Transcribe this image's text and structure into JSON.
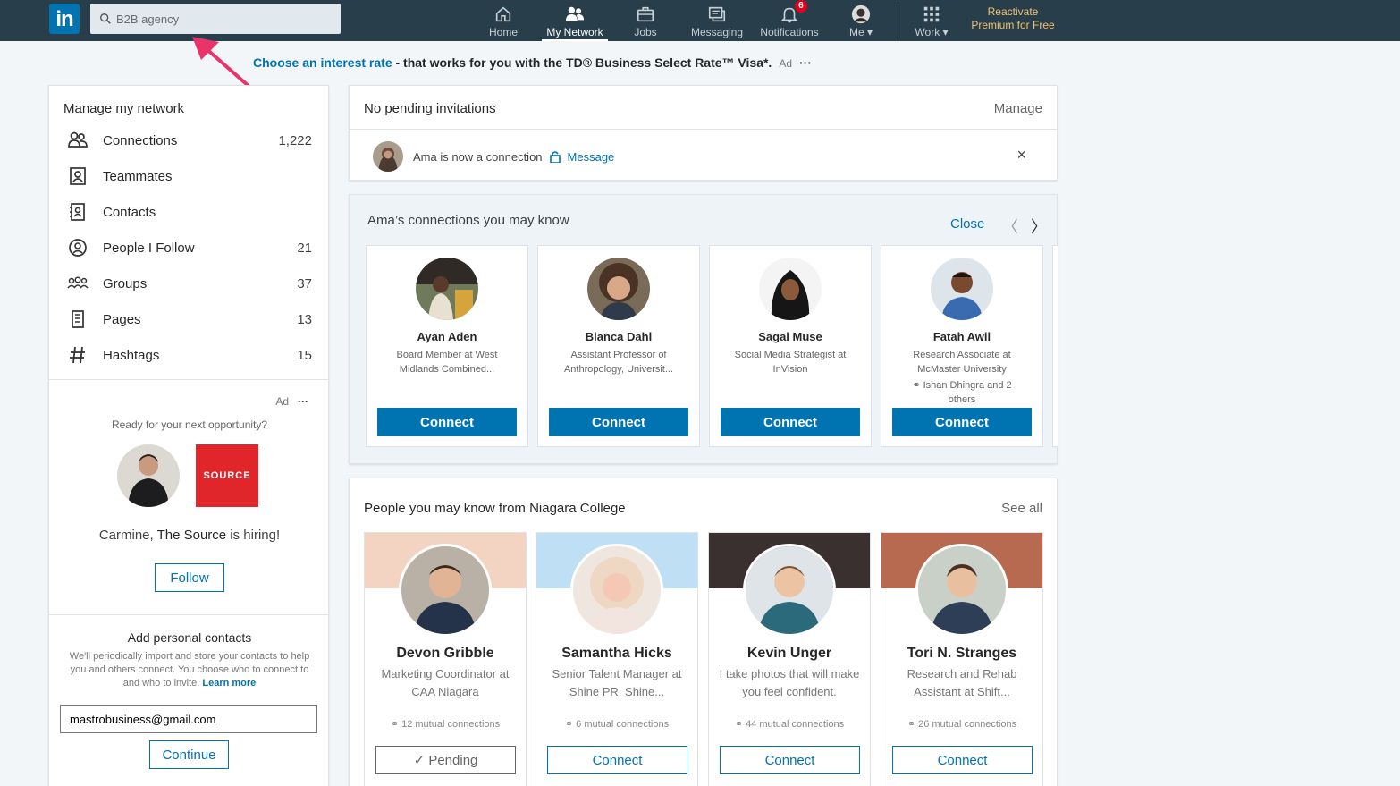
{
  "topbar": {
    "search_value": "B2B agency",
    "nav": [
      {
        "label": "Home",
        "icon": "home-icon"
      },
      {
        "label": "My Network",
        "icon": "network-icon"
      },
      {
        "label": "Jobs",
        "icon": "briefcase-icon"
      },
      {
        "label": "Messaging",
        "icon": "messaging-icon"
      },
      {
        "label": "Notifications",
        "icon": "bell-icon",
        "badge": "6"
      },
      {
        "label": "Me",
        "icon": "avatar"
      },
      {
        "label": "Work",
        "icon": "grid-icon"
      }
    ],
    "premium_line1": "Reactivate",
    "premium_line2": "Premium for Free"
  },
  "ad_banner": {
    "link": "Choose an interest rate",
    "rest": " - that works for you with the TD® Business Select Rate™ Visa*.",
    "ad": "Ad",
    "dots": "···"
  },
  "sidebar": {
    "title": "Manage my network",
    "items": [
      {
        "label": "Connections",
        "count": "1,222",
        "icon": "connections-icon"
      },
      {
        "label": "Teammates",
        "count": "",
        "icon": "teammates-icon"
      },
      {
        "label": "Contacts",
        "count": "",
        "icon": "contacts-icon"
      },
      {
        "label": "People I Follow",
        "count": "21",
        "icon": "follow-icon"
      },
      {
        "label": "Groups",
        "count": "37",
        "icon": "groups-icon"
      },
      {
        "label": "Pages",
        "count": "13",
        "icon": "pages-icon"
      },
      {
        "label": "Hashtags",
        "count": "15",
        "icon": "hashtag-icon"
      }
    ],
    "ad": "Ad",
    "ad_dots": "···",
    "ready": "Ready for your next opportunity?",
    "source_logo": "SOURCE",
    "hiring_prefix": "Carmine, ",
    "hiring_company": "The Source",
    "hiring_suffix": " is hiring!",
    "follow": "Follow",
    "add_title": "Add personal contacts",
    "add_desc": "We'll periodically import and store your contacts to help you and others connect. You choose who to connect to and who to invite. ",
    "learn_more": "Learn more",
    "email": "mastrobusiness@gmail.com",
    "continue": "Continue"
  },
  "invitations": {
    "title": "No pending invitations",
    "manage": "Manage",
    "notice": "Ama is now a connection",
    "message": "Message",
    "close": "×"
  },
  "ama": {
    "title": "Ama’s connections you may know",
    "close": "Close",
    "prev": "〈",
    "next": "〉",
    "people": [
      {
        "name": "Ayan Aden",
        "headline": "Board Member at West Midlands Combined...",
        "mutual": "",
        "action": "Connect"
      },
      {
        "name": "Bianca Dahl",
        "headline": "Assistant Professor of Anthropology, Universit...",
        "mutual": "",
        "action": "Connect"
      },
      {
        "name": "Sagal Muse",
        "headline": "Social Media Strategist at InVision",
        "mutual": "",
        "action": "Connect"
      },
      {
        "name": "Fatah Awil",
        "headline": "Research Associate at McMaster University",
        "mutual": "Ishan Dhingra and 2 others",
        "action": "Connect"
      }
    ]
  },
  "niagara": {
    "title": "People you may know from Niagara College",
    "see_all": "See all",
    "people": [
      {
        "name": "Devon Gribble",
        "headline": "Marketing Coordinator at CAA Niagara",
        "mutual": "12 mutual connections",
        "action": "✓ Pending"
      },
      {
        "name": "Samantha Hicks",
        "headline": "Senior Talent Manager at Shine PR, Shine...",
        "mutual": "6 mutual connections",
        "action": "Connect"
      },
      {
        "name": "Kevin Unger",
        "headline": "I take photos that will make you feel confident.",
        "mutual": "44 mutual connections",
        "action": "Connect"
      },
      {
        "name": "Tori N. Stranges",
        "headline": "Research and Rehab Assistant at Shift...",
        "mutual": "26 mutual connections",
        "action": "Connect"
      }
    ]
  },
  "colors": {
    "brand": "#0073b1",
    "topbar": "#283e4a",
    "annotation_arrow": "#e8336b"
  }
}
